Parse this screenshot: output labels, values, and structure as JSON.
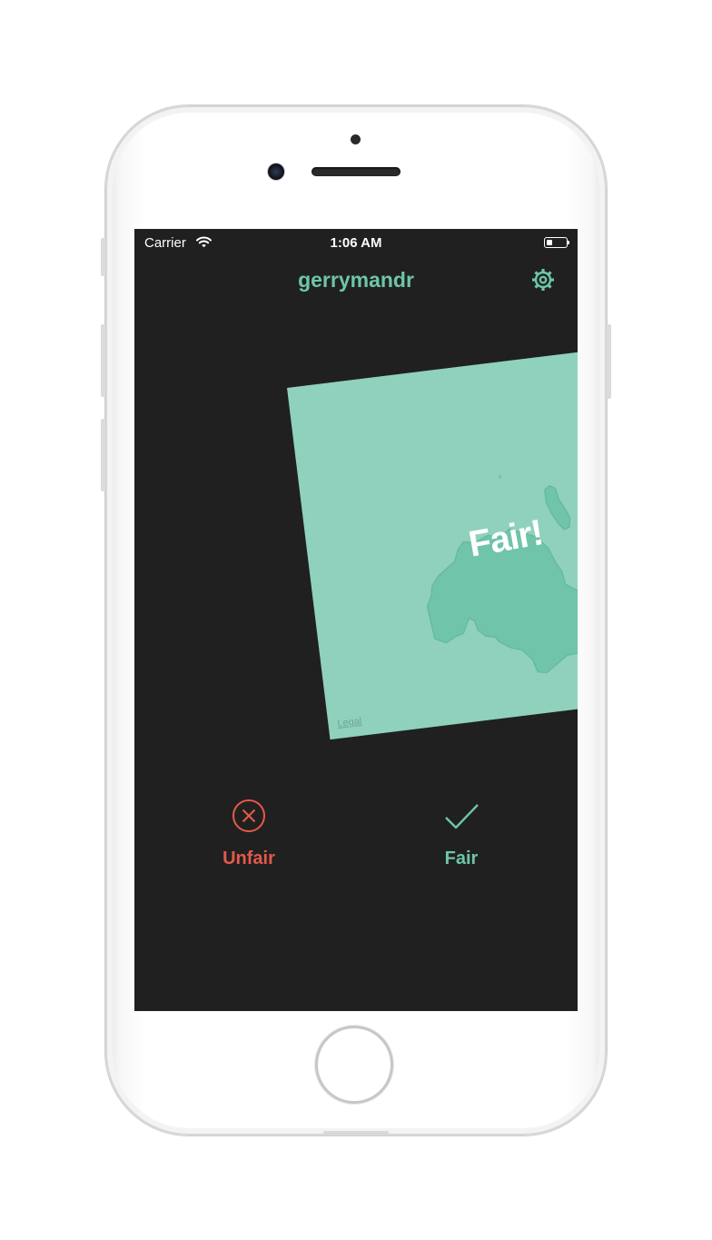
{
  "status_bar": {
    "carrier": "Carrier",
    "time": "1:06 AM",
    "wifi_icon": "wifi-icon",
    "battery_icon": "battery-icon"
  },
  "nav": {
    "title": "gerrymandr",
    "settings_icon": "gear-icon"
  },
  "card": {
    "verdict_overlay": "Fair!",
    "legal_link": "Legal",
    "fill_color": "#8fd1bc",
    "district_color": "#6fc4aa"
  },
  "actions": {
    "unfair": {
      "label": "Unfair",
      "icon": "close-circle-icon",
      "color": "#e5594a"
    },
    "fair": {
      "label": "Fair",
      "icon": "checkmark-icon",
      "color": "#6ec5aa"
    }
  },
  "colors": {
    "screen_bg": "#202020",
    "accent": "#6ec5aa"
  }
}
